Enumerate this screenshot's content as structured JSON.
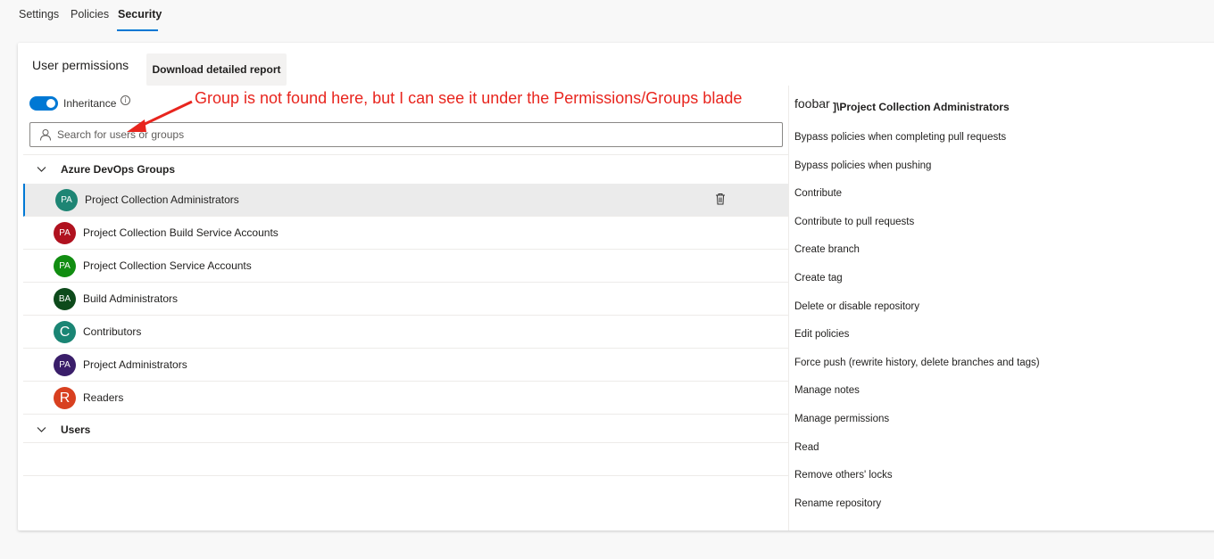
{
  "tabs": [
    {
      "label": "Settings"
    },
    {
      "label": "Policies"
    },
    {
      "label": "Security"
    }
  ],
  "page": {
    "title": "User permissions",
    "download_label": "Download detailed report",
    "inheritance_label": "Inheritance",
    "inheritance_on": true,
    "info_glyph": "i",
    "search_placeholder": "Search for users or groups"
  },
  "annotation": "Group is not found here, but I can see it under the Permissions/Groups blade",
  "groups_section": {
    "label": "Azure DevOps Groups",
    "items": [
      {
        "initials": "PA",
        "name": "Project Collection Administrators",
        "color": "#1e8574",
        "selected": true
      },
      {
        "initials": "PA",
        "name": "Project Collection Build Service Accounts",
        "color": "#b0121f"
      },
      {
        "initials": "PA",
        "name": "Project Collection Service Accounts",
        "color": "#118d11"
      },
      {
        "initials": "BA",
        "name": "Build Administrators",
        "color": "#0d4a1b"
      },
      {
        "initials": "C",
        "name": "Contributors",
        "color": "#1a8574"
      },
      {
        "initials": "PA",
        "name": "Project Administrators",
        "color": "#3a1e6a"
      },
      {
        "initials": "R",
        "name": "Readers",
        "color": "#d84020"
      }
    ]
  },
  "users_section": {
    "label": "Users"
  },
  "permissions": {
    "org": "foobar",
    "title_suffix": "]\\Project Collection Administrators",
    "items": [
      "Bypass policies when completing pull requests",
      "Bypass policies when pushing",
      "Contribute",
      "Contribute to pull requests",
      "Create branch",
      "Create tag",
      "Delete or disable repository",
      "Edit policies",
      "Force push (rewrite history, delete branches and tags)",
      "Manage notes",
      "Manage permissions",
      "Read",
      "Remove others' locks",
      "Rename repository"
    ]
  },
  "colors": {
    "accent": "#0078d4",
    "annotation": "#e8251e"
  },
  "icons": {
    "search": "person-search-icon",
    "trash": "trash-icon",
    "chevron": "chevron-down-icon",
    "info": "info-icon"
  }
}
